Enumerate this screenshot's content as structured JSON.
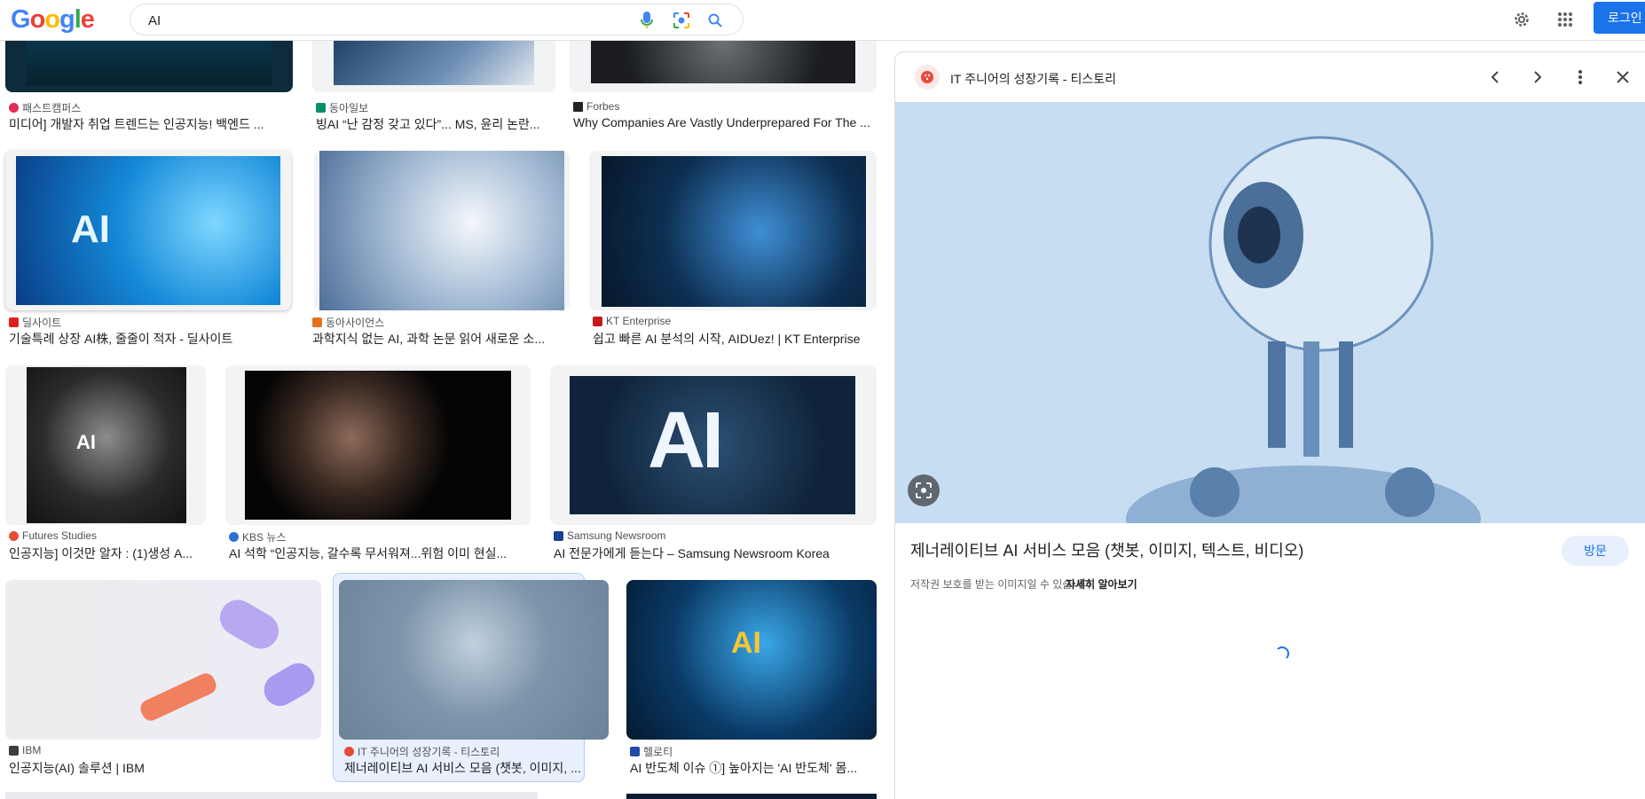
{
  "header": {
    "logo_letters": [
      "G",
      "o",
      "o",
      "g",
      "l",
      "e"
    ],
    "logo_colors": [
      "#4285F4",
      "#EA4335",
      "#FBBC05",
      "#4285F4",
      "#34A853",
      "#EA4335"
    ],
    "search_value": "AI",
    "login_label": "로그인",
    "icons": [
      "microphone-icon",
      "camera-lens-icon",
      "search-icon",
      "gear-icon",
      "apps-grid-icon"
    ]
  },
  "results": [
    {
      "source": "패스트캠퍼스",
      "title": "미디어] 개발자 취업 트렌드는 인공지능! 백엔드 ..."
    },
    {
      "source": "동아일보",
      "title": "빙AI “난 감정 갖고 있다”... MS, 윤리 논란..."
    },
    {
      "source": "Forbes",
      "title": "Why Companies Are Vastly Underprepared For The ..."
    },
    {
      "source": "딜사이트",
      "title": "기술특례 상장 AI株, 줄줄이 적자 - 딜사이트"
    },
    {
      "source": "동아사이언스",
      "title": "과학지식 없는 AI, 과학 논문 읽어 새로운 소..."
    },
    {
      "source": "KT Enterprise",
      "title": "쉽고 빠른 AI 분석의 시작, AIDUez! | KT Enterprise"
    },
    {
      "source": "Futures Studies",
      "title": "인공지능] 이것만 알자 : (1)생성 A..."
    },
    {
      "source": "KBS 뉴스",
      "title": "AI 석학 “인공지능, 갈수록 무서워져...위험 이미 현실..."
    },
    {
      "source": "Samsung Newsroom",
      "title": "AI 전문가에게 듣는다 – Samsung Newsroom Korea"
    },
    {
      "source": "IBM",
      "title": "인공지능(AI) 솔루션 | IBM"
    },
    {
      "source": "IT 주니어의 성장기록 - 티스토리",
      "title": "제너레이티브 AI 서비스 모음 (챗봇, 이미지, ..."
    },
    {
      "source": "헬로티",
      "title": "AI 반도체 이슈 ①] 높아지는 'AI 반도체' 몸..."
    }
  ],
  "image_text": {
    "ai_a": "AI",
    "ai_c": "AI",
    "ai_d": "AI",
    "ai_f": "AI"
  },
  "panel": {
    "site": "IT 주니어의 성장기록 - 티스토리",
    "title": "제너레이티브 AI 서비스 모음 (챗봇, 이미지, 텍스트, 비디오)",
    "visit_label": "방문",
    "copyright_note": "저작권 보호를 받는 이미지일 수 있습니다.",
    "learn_more": "자세히 알아보기"
  }
}
